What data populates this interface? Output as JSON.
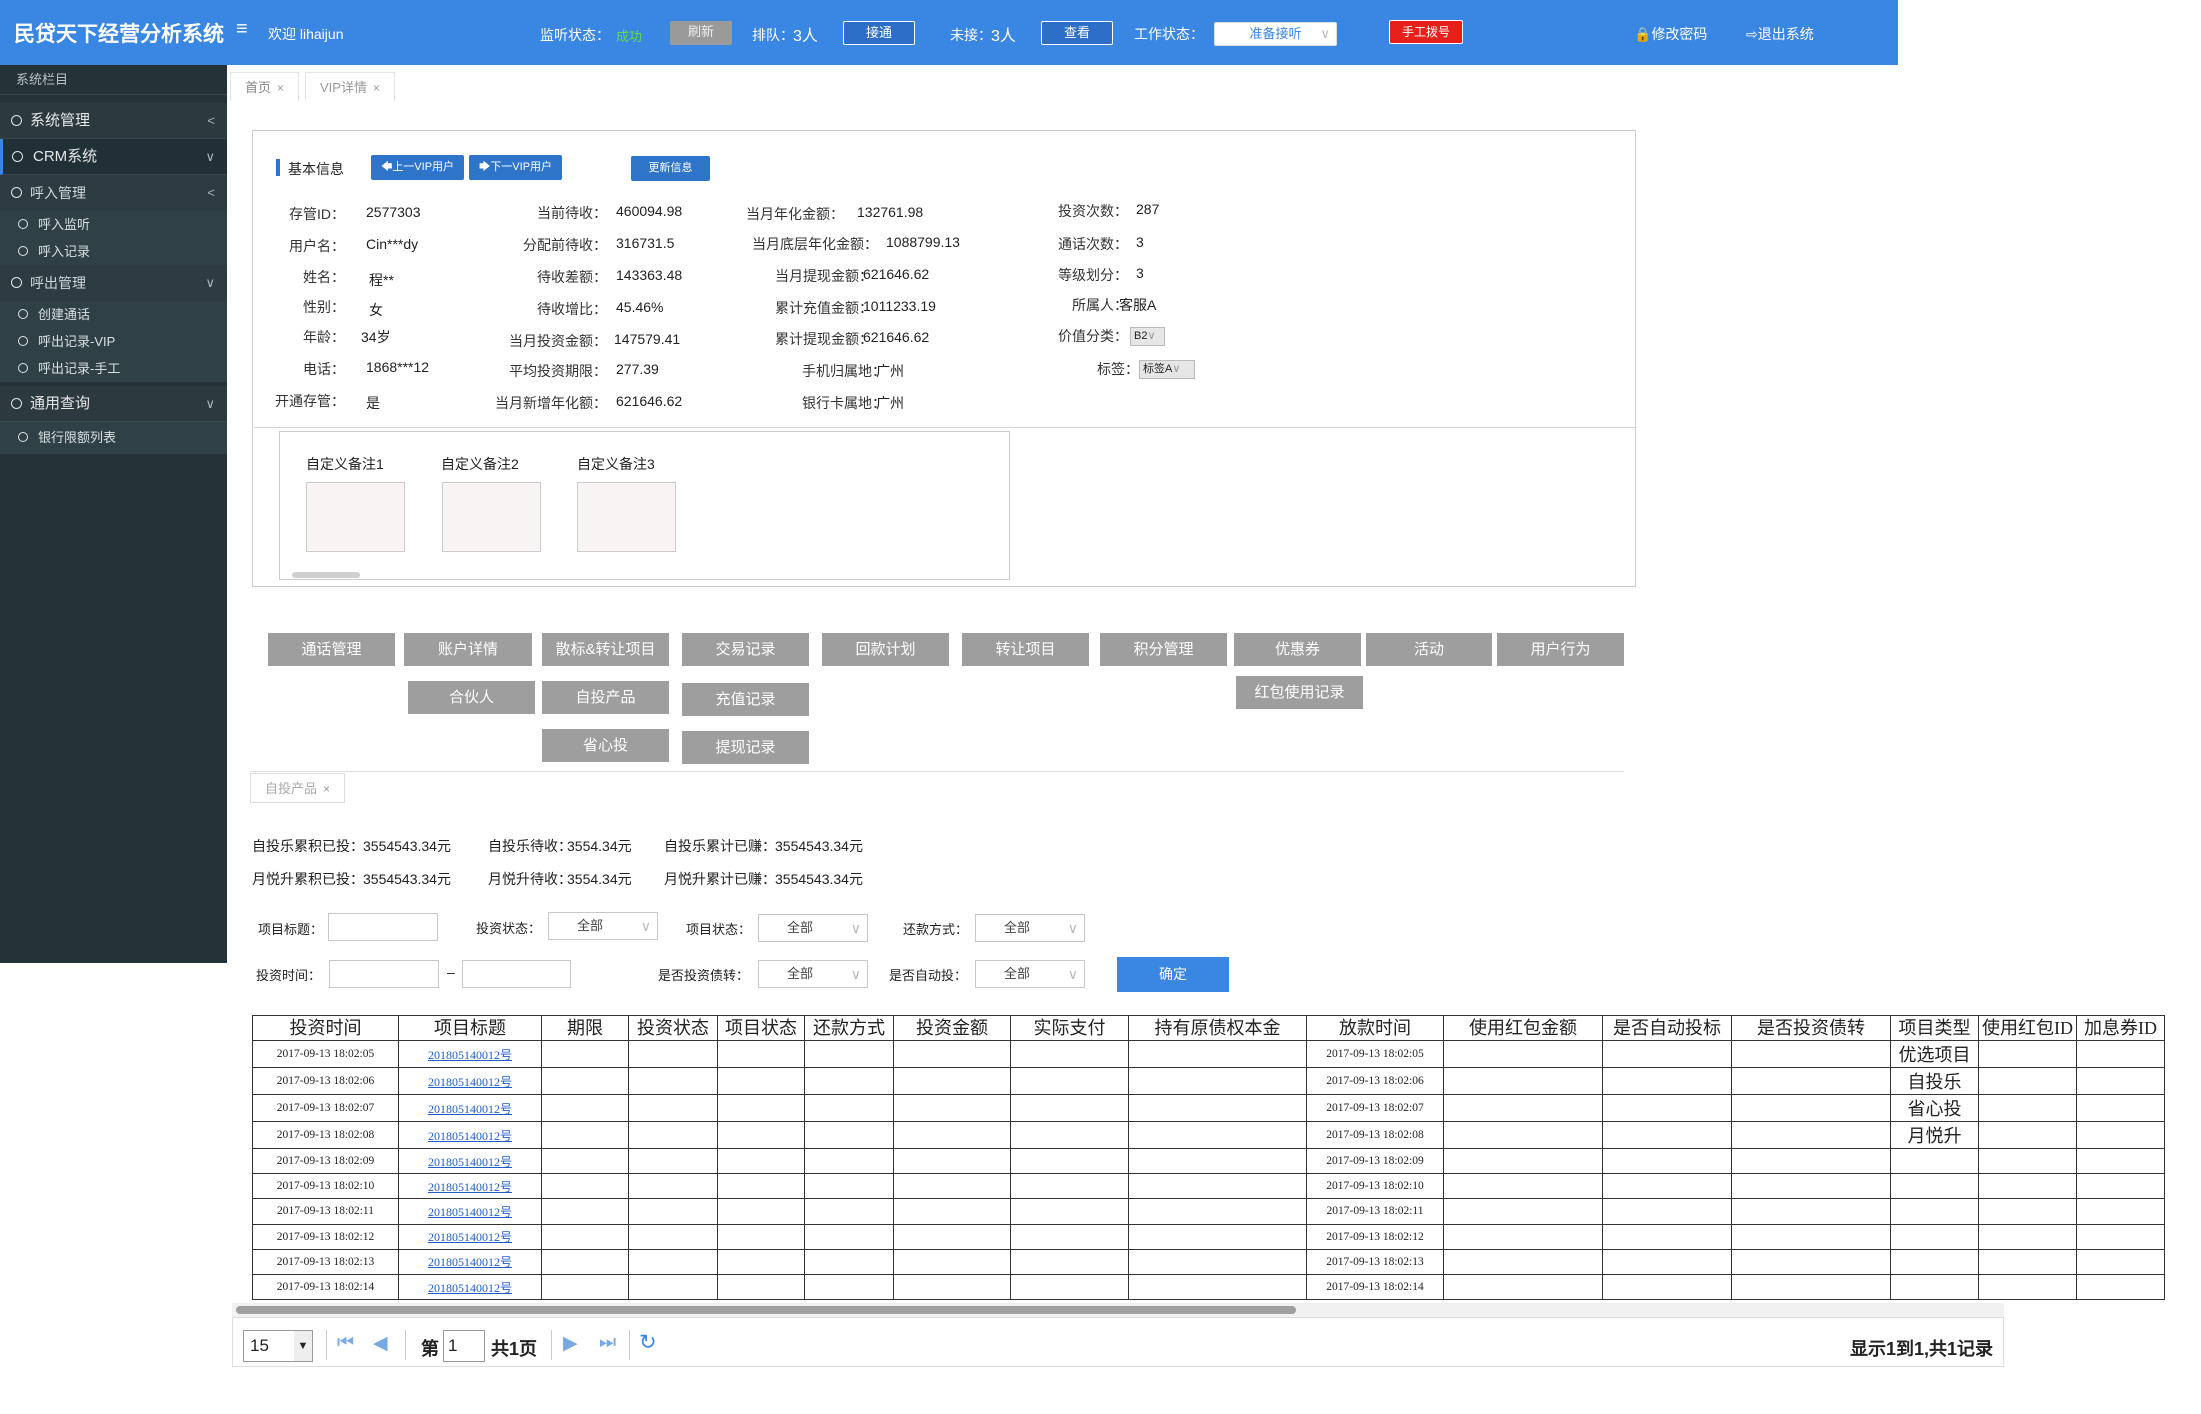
{
  "app": {
    "title": "民贷天下经营分析系统",
    "welcome": "欢迎 lihaijun"
  },
  "topbar": {
    "listen_label": "监听状态：",
    "listen_value": "成功",
    "refresh": "刷新",
    "queue_label": "排队：",
    "queue_value": "3人",
    "connect": "接通",
    "missed_label": "未接：",
    "missed_value": "3人",
    "view": "查看",
    "work_label": "工作状态：",
    "work_value": "准备接听",
    "manual_dial": "手工拨号",
    "change_pwd": "修改密码",
    "logout": "退出系统"
  },
  "colors": {
    "accent": "#3a86e3",
    "success": "#5fdc4f",
    "danger": "#e8201c",
    "sidebar": "#253238"
  },
  "sidebar": {
    "header": "系统栏目",
    "items": [
      {
        "label": "系统管理",
        "level": 1
      },
      {
        "label": "CRM系统",
        "level": 1
      },
      {
        "label": "呼入管理",
        "level": 2
      },
      {
        "label": "呼入监听",
        "level": 3
      },
      {
        "label": "呼入记录",
        "level": 3
      },
      {
        "label": "呼出管理",
        "level": 2
      },
      {
        "label": "创建通话",
        "level": 3
      },
      {
        "label": "呼出记录-VIP",
        "level": 3
      },
      {
        "label": "呼出记录-手工",
        "level": 3
      },
      {
        "label": "通用查询",
        "level": 1
      },
      {
        "label": "银行限额列表",
        "level": 3
      }
    ]
  },
  "tabs": [
    {
      "label": "首页"
    },
    {
      "label": "VIP详情"
    }
  ],
  "basic": {
    "title": "基本信息",
    "prev": "上一VIP用户",
    "next": "下一VIP用户",
    "update": "更新信息",
    "fields": [
      {
        "label": "存管ID：",
        "value": "2577303"
      },
      {
        "label": "用户名：",
        "value": "Cin***dy"
      },
      {
        "label": "姓名：",
        "value": "程**"
      },
      {
        "label": "性别：",
        "value": "女"
      },
      {
        "label": "年龄：",
        "value": "34岁"
      },
      {
        "label": "电话：",
        "value": "1868***12"
      },
      {
        "label": "开通存管：",
        "value": "是"
      },
      {
        "label": "当前待收：",
        "value": "460094.98"
      },
      {
        "label": "分配前待收：",
        "value": "316731.5"
      },
      {
        "label": "待收差额：",
        "value": "143363.48"
      },
      {
        "label": "待收增比：",
        "value": "45.46%"
      },
      {
        "label": "当月投资金额：",
        "value": "147579.41"
      },
      {
        "label": "平均投资期限：",
        "value": "277.39"
      },
      {
        "label": "当月新增年化额：",
        "value": "621646.62"
      },
      {
        "label": "当月年化金额：",
        "value": "132761.98"
      },
      {
        "label": "当月底层年化金额：",
        "value": "1088799.13"
      },
      {
        "label": "当月提现金额：",
        "value": "621646.62"
      },
      {
        "label": "累计充值金额：",
        "value": "1011233.19"
      },
      {
        "label": "累计提现金额：",
        "value": "621646.62"
      },
      {
        "label": "手机归属地：",
        "value": "广州"
      },
      {
        "label": "银行卡属地：",
        "value": "广州"
      },
      {
        "label": "投资次数：",
        "value": "287"
      },
      {
        "label": "通话次数：",
        "value": "3"
      },
      {
        "label": "等级划分：",
        "value": "3"
      },
      {
        "label": "所属人：",
        "value": "客服A"
      },
      {
        "label": "价值分类：",
        "value": "B2"
      },
      {
        "label": "标签：",
        "value": "标签A"
      }
    ],
    "notes": [
      "自定义备注1",
      "自定义备注2",
      "自定义备注3"
    ]
  },
  "actions": [
    "通话管理",
    "账户详情",
    "散标&转让项目",
    "交易记录",
    "回款计划",
    "转让项目",
    "积分管理",
    "优惠券",
    "活动",
    "用户行为",
    "合伙人",
    "自投产品",
    "充值记录",
    "红包使用记录",
    "省心投",
    "提现记录"
  ],
  "subtab": "自投产品",
  "summary": [
    {
      "label": "自投乐累积已投：",
      "value": "3554543.34元"
    },
    {
      "label": "自投乐待收：",
      "value": "3554.34元"
    },
    {
      "label": "自投乐累计已赚：",
      "value": "3554543.34元"
    },
    {
      "label": "月悦升累积已投：",
      "value": "3554543.34元"
    },
    {
      "label": "月悦升待收：",
      "value": "3554.34元"
    },
    {
      "label": "月悦升累计已赚：",
      "value": "3554543.34元"
    }
  ],
  "filters": {
    "title_label": "项目标题：",
    "invest_status_label": "投资状态：",
    "project_status_label": "项目状态：",
    "repay_label": "还款方式：",
    "time_label": "投资时间：",
    "range_sep": "–",
    "transfer_label": "是否投资债转：",
    "auto_label": "是否自动投：",
    "all": "全部",
    "confirm": "确定"
  },
  "table": {
    "columns": [
      "投资时间",
      "项目标题",
      "期限",
      "投资状态",
      "项目状态",
      "还款方式",
      "投资金额",
      "实际支付",
      "持有原债权本金",
      "放款时间",
      "使用红包金额",
      "是否自动投标",
      "是否投资债转",
      "项目类型",
      "使用红包ID",
      "加息券ID"
    ],
    "rows": [
      {
        "invest_time": "2017-09-13 18:02:05",
        "title": "201805140012号",
        "loan_time": "2017-09-13 18:02:05",
        "type": "优选项目"
      },
      {
        "invest_time": "2017-09-13 18:02:06",
        "title": "201805140012号",
        "loan_time": "2017-09-13 18:02:06",
        "type": "自投乐"
      },
      {
        "invest_time": "2017-09-13 18:02:07",
        "title": "201805140012号",
        "loan_time": "2017-09-13 18:02:07",
        "type": "省心投"
      },
      {
        "invest_time": "2017-09-13 18:02:08",
        "title": "201805140012号",
        "loan_time": "2017-09-13 18:02:08",
        "type": "月悦升"
      },
      {
        "invest_time": "2017-09-13 18:02:09",
        "title": "201805140012号",
        "loan_time": "2017-09-13 18:02:09",
        "type": ""
      },
      {
        "invest_time": "2017-09-13 18:02:10",
        "title": "201805140012号",
        "loan_time": "2017-09-13 18:02:10",
        "type": ""
      },
      {
        "invest_time": "2017-09-13 18:02:11",
        "title": "201805140012号",
        "loan_time": "2017-09-13 18:02:11",
        "type": ""
      },
      {
        "invest_time": "2017-09-13 18:02:12",
        "title": "201805140012号",
        "loan_time": "2017-09-13 18:02:12",
        "type": ""
      },
      {
        "invest_time": "2017-09-13 18:02:13",
        "title": "201805140012号",
        "loan_time": "2017-09-13 18:02:13",
        "type": ""
      },
      {
        "invest_time": "2017-09-13 18:02:14",
        "title": "201805140012号",
        "loan_time": "2017-09-13 18:02:14",
        "type": ""
      }
    ]
  },
  "pager": {
    "page_size": "15",
    "page_prefix": "第",
    "page": "1",
    "page_suffix": "共1页",
    "summary": "显示1到1,共1记录"
  }
}
